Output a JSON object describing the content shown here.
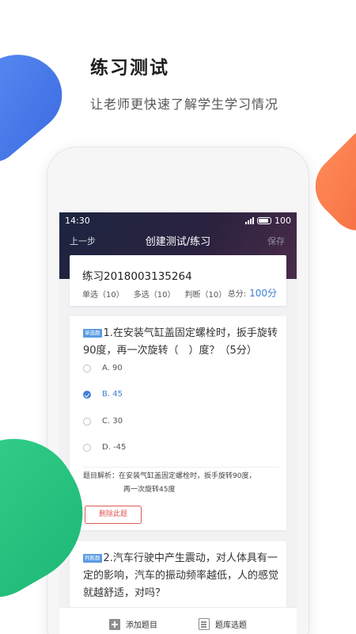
{
  "promo": {
    "title": "练习测试",
    "subtitle": "让老师更快速了解学生学习情况"
  },
  "status_bar": {
    "time": "14:30",
    "battery": "100"
  },
  "nav": {
    "back": "上一步",
    "title": "创建测试/练习",
    "save": "保存"
  },
  "test_info": {
    "name": "练习2018003135264",
    "single_choice": "单选（10）",
    "multi_choice": "多选（10）",
    "judgement": "判断（10）",
    "total_label": "总分:",
    "total_value": "100分"
  },
  "question1": {
    "tag": "单选题",
    "text": "1.在安装气缸盖固定螺栓时，扳手旋转90度，再一次旋转（　）度？（5分）",
    "options": [
      {
        "label": "A. 90",
        "selected": false
      },
      {
        "label": "B. 45",
        "selected": true
      },
      {
        "label": "C. 30",
        "selected": false
      },
      {
        "label": "D. -45",
        "selected": false
      }
    ],
    "analysis_line1": "题目解析：在安装气缸盖固定螺栓时，扳手旋转90度，",
    "analysis_line2": "再一次旋转45度",
    "delete_label": "删除此题"
  },
  "question2": {
    "tag": "判断题",
    "text": "2.汽车行驶中产生震动，对人体具有一定的影响，汽车的振动频率越低，人的感觉就越舒适，对吗？"
  },
  "toolbar": {
    "add_label": "添加题目",
    "bank_label": "题库选题"
  }
}
